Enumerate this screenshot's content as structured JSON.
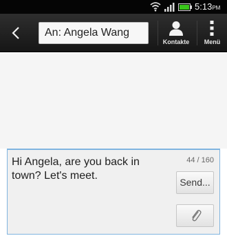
{
  "status_bar": {
    "time": "5:13",
    "ampm": "PM",
    "icons": [
      "wifi-icon",
      "signal-icon",
      "battery-icon"
    ],
    "battery_color": "#39c51a"
  },
  "action_bar": {
    "back_icon": "chevron-left-icon",
    "recipient": "An: Angela Wang",
    "contacts_label": "Kontakte",
    "contacts_icon": "person-icon",
    "menu_label": "Menü",
    "menu_icon": "vertical-dots-icon"
  },
  "compose": {
    "message": "Hi Angela, are you back in town? Let's meet.",
    "char_count": "44 / 160",
    "send_label": "Send...",
    "attach_icon": "paperclip-icon",
    "accent_color": "#7fb4e0"
  }
}
